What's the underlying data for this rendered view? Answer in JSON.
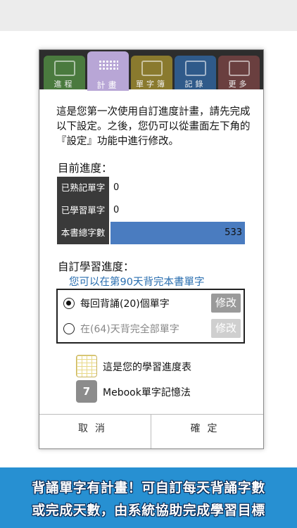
{
  "tabs": [
    {
      "label": "進程",
      "icon": "keyboard-icon",
      "color": "#4a7a3e"
    },
    {
      "label": "計畫",
      "icon": "calendar-dots-icon",
      "color": "#b8a6d6",
      "active": true
    },
    {
      "label": "單字簿",
      "icon": "wordbook-icon",
      "color": "#8a7a2e"
    },
    {
      "label": "記錄",
      "icon": "bar-chart-icon",
      "color": "#2f5a8a"
    },
    {
      "label": "更多",
      "icon": "more-icon",
      "color": "#6a3f3f"
    }
  ],
  "intro": "這是您第一次使用自訂進度計畫，請先完成以下設定。之後，您仍可以從畫面左下角的『設定』功能中進行修改。",
  "progress": {
    "title": "目前進度：",
    "rows": [
      {
        "label": "已熟記單字",
        "value": "0"
      },
      {
        "label": "已學習單字",
        "value": "0"
      },
      {
        "label": "本書總字數",
        "value": "533"
      }
    ]
  },
  "plan": {
    "title": "自訂學習進度：",
    "subtitle": "您可以在第90天背完本書單字",
    "options": [
      {
        "text": "每回背誦(20)個單字",
        "selected": true,
        "button": "修改"
      },
      {
        "text": "在(64)天背完全部單字",
        "selected": false,
        "button": "修改"
      }
    ]
  },
  "links": [
    {
      "icon": "schedule-table-icon",
      "text": "這是您的學習進度表"
    },
    {
      "icon": "lightbulb-icon",
      "icon_glyph": "7",
      "text": "Mebook單字記憶法"
    }
  ],
  "footer": {
    "cancel": "取消",
    "confirm": "確定"
  },
  "banner": {
    "line1": "背誦單字有計畫！可自訂每天背誦字數",
    "line2": "或完成天數，由系統協助完成學習目標"
  },
  "colors": {
    "accent_blue": "#4a7cc0",
    "link_blue": "#2b6fb0",
    "banner_bg": "#2790d2",
    "active_tab": "#b8a6d6"
  }
}
